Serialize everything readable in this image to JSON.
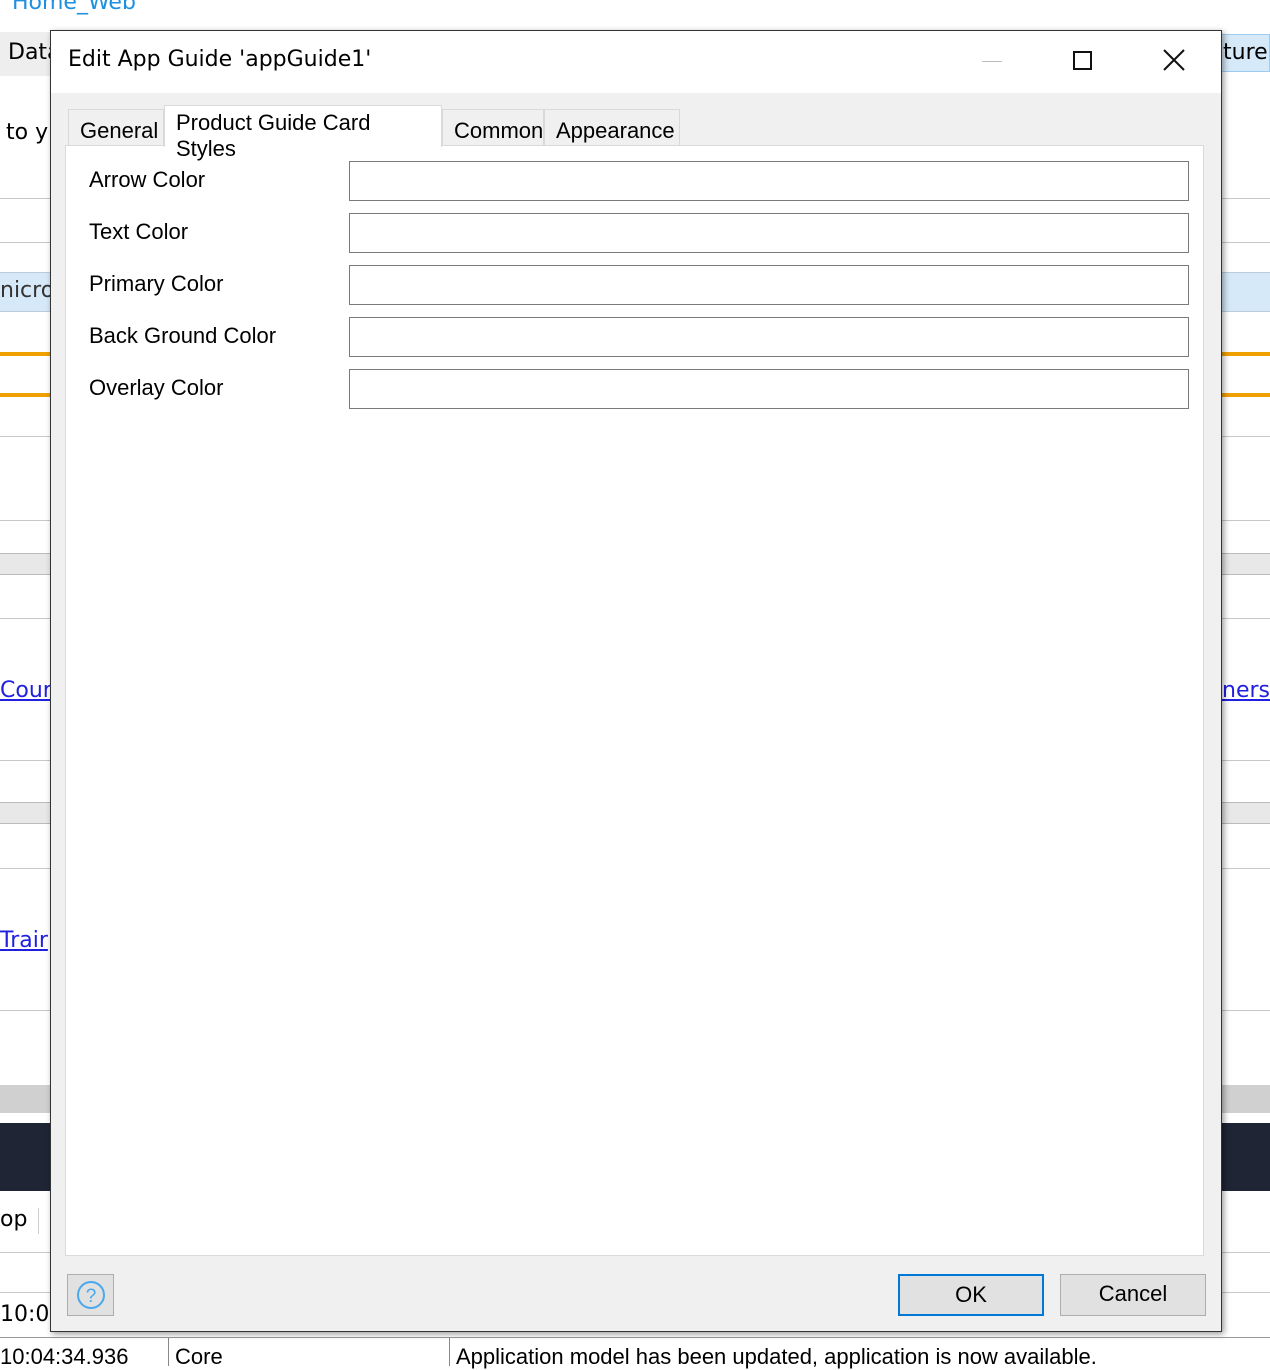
{
  "background": {
    "project_link": "Home_Web",
    "tab_partial_left": "Data",
    "tab_partial_right": "ture",
    "text_partial": "to y",
    "band_partial": "nicrof",
    "link_partial_1": "Cour",
    "link_partial_2": "Trair",
    "link_partial_right": "ners",
    "toolbar_partial": "op",
    "log_time_partial": "10:0",
    "log_row": {
      "time": "10:04:34.936",
      "source": "Core",
      "message": "Application model has been updated, application is now available."
    }
  },
  "dialog": {
    "title": "Edit App Guide 'appGuide1'",
    "minimize_icon": "minimize-icon",
    "maximize_icon": "maximize-icon",
    "close_icon": "close-icon",
    "tabs": [
      {
        "label": "General",
        "active": false
      },
      {
        "label": "Product Guide Card Styles",
        "active": true
      },
      {
        "label": "Common",
        "active": false
      },
      {
        "label": "Appearance",
        "active": false
      }
    ],
    "fields": [
      {
        "label": "Arrow Color",
        "value": ""
      },
      {
        "label": "Text Color",
        "value": ""
      },
      {
        "label": "Primary Color",
        "value": ""
      },
      {
        "label": "Back Ground Color",
        "value": ""
      },
      {
        "label": "Overlay Color",
        "value": ""
      }
    ],
    "help_icon": "help-icon",
    "ok_label": "OK",
    "cancel_label": "Cancel"
  },
  "colors": {
    "accent": "#0078d7",
    "orange": "#f0a000",
    "dark_band": "#1f2535",
    "light_band": "#d6e9f8"
  }
}
